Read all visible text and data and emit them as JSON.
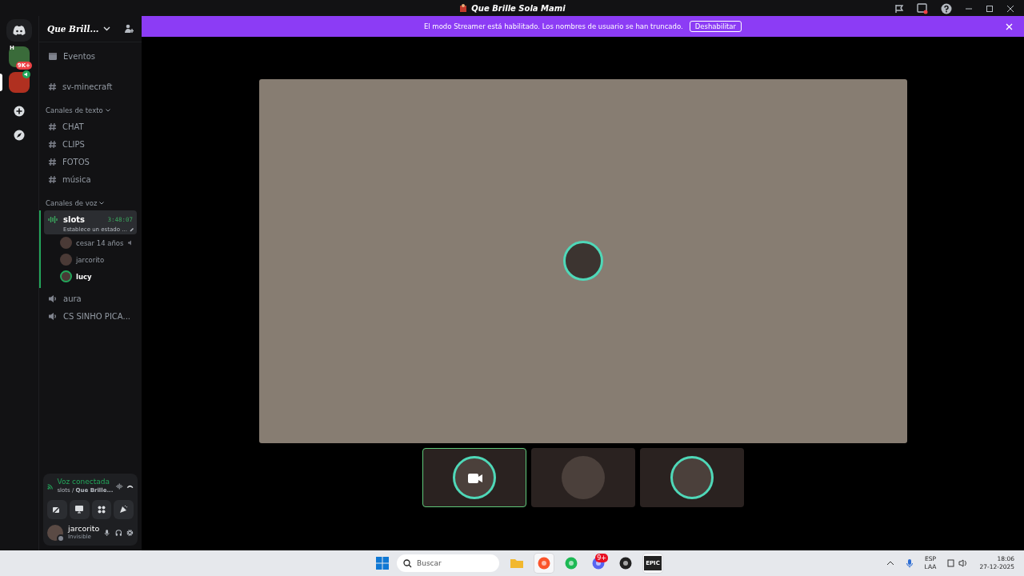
{
  "window": {
    "title": "Que Brille Sola Mami"
  },
  "banner": {
    "text": "El modo Streamer está habilitado. Los nombres de usuario se han truncado.",
    "button": "Deshabilitar"
  },
  "servers": [
    {
      "label": "H",
      "badge": "9K+",
      "selected": false,
      "color": "#3a6b3a"
    },
    {
      "selected": true,
      "color": "#b03020"
    }
  ],
  "server": {
    "name": "Que Brill..."
  },
  "channels": [
    {
      "kind": "events",
      "name": "Eventos"
    },
    {
      "kind": "text",
      "name": "sv-minecraft"
    },
    {
      "kind": "category",
      "name": "Canales de texto"
    },
    {
      "kind": "text",
      "name": "CHAT"
    },
    {
      "kind": "text",
      "name": "CLIPS"
    },
    {
      "kind": "text",
      "name": "FOTOS"
    },
    {
      "kind": "text",
      "name": "música"
    },
    {
      "kind": "category",
      "name": "Canales de voz"
    },
    {
      "kind": "voice",
      "name": "slots",
      "selected": true,
      "elapsed": "3:48:07",
      "status": "Establece un estado ...",
      "members": [
        {
          "name": "cesar 14 años",
          "speaking": false,
          "muted": true
        },
        {
          "name": "jarcorito",
          "speaking": false,
          "muted": false
        },
        {
          "name": "lucy",
          "speaking": true,
          "muted": false
        }
      ]
    },
    {
      "kind": "voice",
      "name": "aura",
      "selected": false
    },
    {
      "kind": "voice",
      "name": "CS SINHO PICA...",
      "selected": false
    }
  ],
  "voice_panel": {
    "status": "Voz conectada",
    "location": "slots / **Que Brille...**"
  },
  "user": {
    "name": "jarcorito",
    "status": "Invisible"
  },
  "stage": {
    "speaking": true
  },
  "tiles": [
    {
      "selected": true,
      "speaking": true,
      "camera": true
    },
    {
      "selected": false,
      "speaking": false,
      "camera": false
    },
    {
      "selected": false,
      "speaking": true,
      "camera": false
    }
  ],
  "taskbar": {
    "search": {
      "placeholder": "Buscar"
    },
    "apps": [
      {
        "kind": "files",
        "selected": false
      },
      {
        "kind": "brave",
        "selected": true
      },
      {
        "kind": "spotify",
        "selected": false
      },
      {
        "kind": "discord",
        "selected": false,
        "badge": "9+"
      },
      {
        "kind": "steam",
        "selected": false
      },
      {
        "kind": "epic",
        "selected": true,
        "label": "EPIC"
      }
    ],
    "language": "ESP",
    "layout": "LAA",
    "time": "18:06",
    "date": "27-12-2025"
  }
}
